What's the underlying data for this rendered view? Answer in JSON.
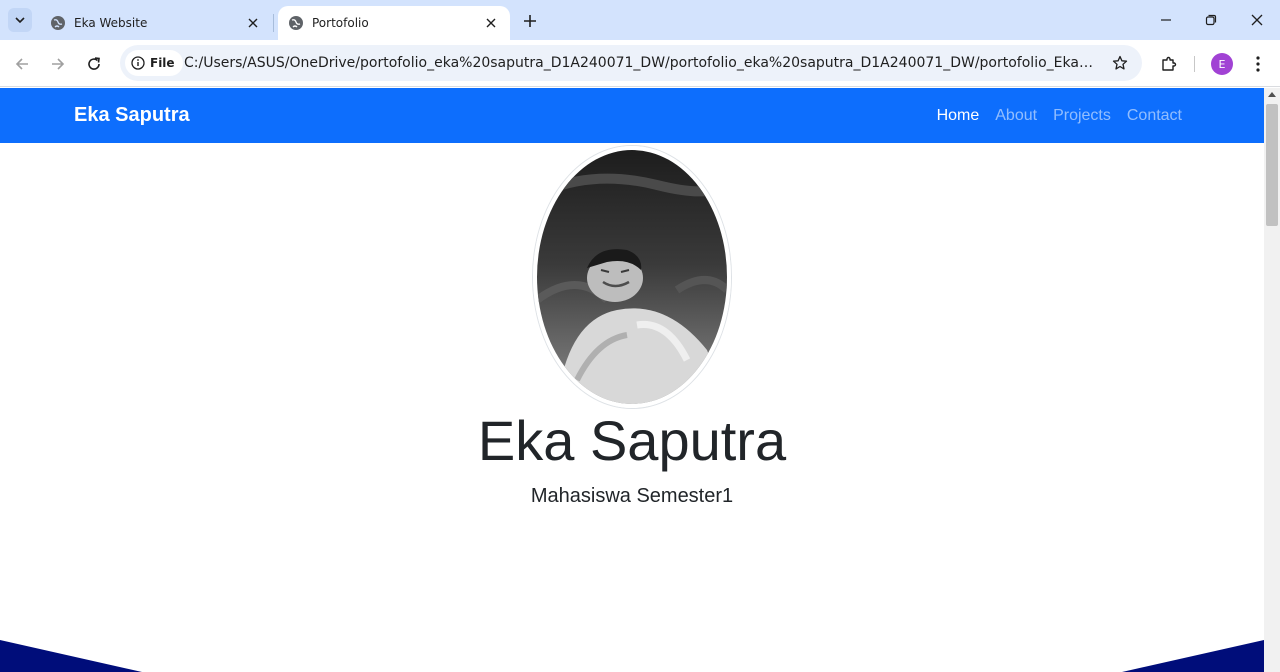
{
  "browser": {
    "tabs": [
      {
        "title": "Eka Website",
        "active": false
      },
      {
        "title": "Portofolio",
        "active": true
      }
    ],
    "address": {
      "chip_label": "File",
      "url": "C:/Users/ASUS/OneDrive/portofolio_eka%20saputra_D1A240071_DW/portofolio_eka%20saputra_D1A240071_DW/portofolio_Eka%20saputra/inde..."
    },
    "profile_initial": "E"
  },
  "page": {
    "navbar": {
      "brand": "Eka Saputra",
      "links": [
        {
          "label": "Home",
          "active": true
        },
        {
          "label": "About",
          "active": false
        },
        {
          "label": "Projects",
          "active": false
        },
        {
          "label": "Contact",
          "active": false
        }
      ]
    },
    "hero": {
      "name": "Eka Saputra",
      "subtitle": "Mahasiswa Semester1"
    }
  },
  "colors": {
    "tabstrip": "#d3e3fd",
    "navbar": "#0d6efd",
    "wave": "#000d7a",
    "profile": "#a142d4"
  }
}
